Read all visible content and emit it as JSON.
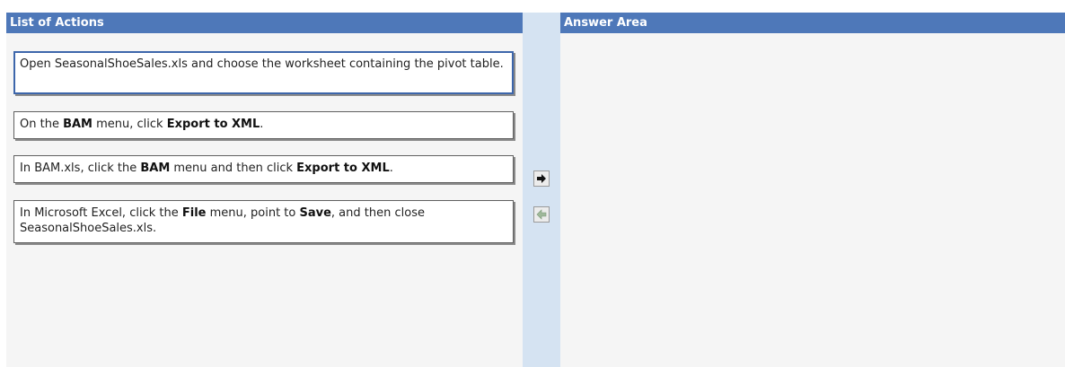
{
  "left_panel": {
    "title": "List of Actions",
    "items": [
      {
        "segments": [
          "Open SeasonalShoeSales.xls and choose the worksheet containing the pivot table."
        ],
        "bold": [
          false
        ],
        "selected": true
      },
      {
        "segments": [
          "On the ",
          "BAM",
          " menu, click ",
          "Export to XML",
          "."
        ],
        "bold": [
          false,
          true,
          false,
          true,
          false
        ],
        "selected": false
      },
      {
        "segments": [
          "In BAM.xls, click the ",
          "BAM",
          " menu and then click ",
          "Export to XML",
          "."
        ],
        "bold": [
          false,
          true,
          false,
          true,
          false
        ],
        "selected": false
      },
      {
        "segments": [
          "In Microsoft Excel, click the ",
          "File",
          " menu, point to ",
          "Save",
          ", and then close SeasonalShoeSales.xls."
        ],
        "bold": [
          false,
          true,
          false,
          true,
          false
        ],
        "selected": false
      }
    ]
  },
  "right_panel": {
    "title": "Answer Area",
    "items": []
  },
  "controls": {
    "move_right_icon": "arrow-right-icon",
    "move_left_icon": "arrow-left-icon",
    "move_left_enabled": false
  },
  "colors": {
    "header": "#4e78b9",
    "panel_bg": "#f5f5f5",
    "middle_strip": "#d5e3f2",
    "selected_border": "#3d66ab"
  }
}
